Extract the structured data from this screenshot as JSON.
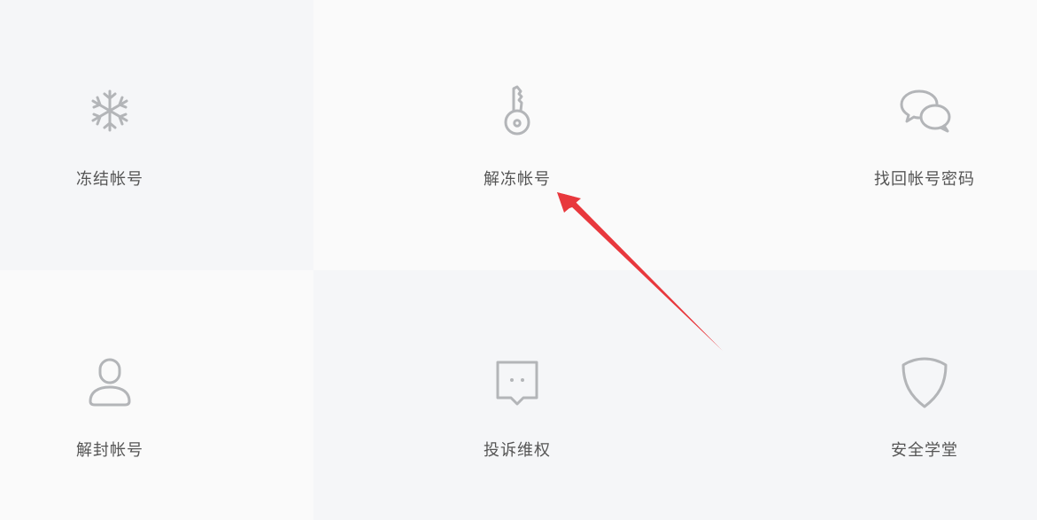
{
  "tiles": [
    {
      "label": "冻结帐号",
      "icon": "snowflake-icon"
    },
    {
      "label": "解冻帐号",
      "icon": "key-icon"
    },
    {
      "label": "找回帐号密码",
      "icon": "chat-bubbles-icon"
    },
    {
      "label": "解封帐号",
      "icon": "user-icon"
    },
    {
      "label": "投诉维权",
      "icon": "complaint-bubble-icon"
    },
    {
      "label": "安全学堂",
      "icon": "shield-icon"
    }
  ],
  "colors": {
    "icon": "#b3b5b8",
    "label": "#555555",
    "arrow": "#e8383d",
    "tile_light": "#fafafa",
    "tile_shade": "#f5f6f8"
  }
}
